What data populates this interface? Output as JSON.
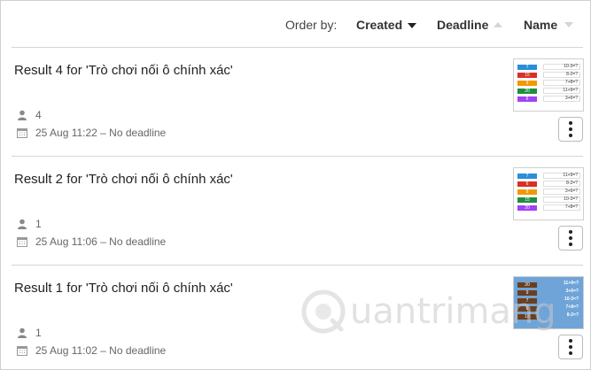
{
  "order_bar": {
    "label": "Order by:",
    "sorts": [
      {
        "label": "Created",
        "state": "active-desc"
      },
      {
        "label": "Deadline",
        "state": "inactive-asc"
      },
      {
        "label": "Name",
        "state": "inactive-desc"
      }
    ]
  },
  "results": [
    {
      "title": "Result 4 for 'Trò chơi nối ô chính xác'",
      "count": "4",
      "date": "25 Aug 11:22 – No deadline",
      "thumb": {
        "tiles": [
          {
            "text": "7",
            "color": "#2a8fd9"
          },
          {
            "text": "15",
            "color": "#d93025"
          },
          {
            "text": "9",
            "color": "#f29900"
          },
          {
            "text": "20",
            "color": "#1e8e3e"
          },
          {
            "text": "6",
            "color": "#a142f4"
          }
        ],
        "equations": [
          "10-3=?",
          "8-2=?",
          "7+8=?",
          "11+9=?",
          "3+6=?"
        ]
      }
    },
    {
      "title": "Result 2 for 'Trò chơi nối ô chính xác'",
      "count": "1",
      "date": "25 Aug 11:06 – No deadline",
      "thumb": {
        "tiles": [
          {
            "text": "7",
            "color": "#2a8fd9"
          },
          {
            "text": "6",
            "color": "#d93025"
          },
          {
            "text": "9",
            "color": "#f29900"
          },
          {
            "text": "15",
            "color": "#1e8e3e"
          },
          {
            "text": "20",
            "color": "#a142f4"
          }
        ],
        "equations": [
          "11+9=?",
          "8-2=?",
          "3+6=?",
          "10-3=?",
          "7+8=?"
        ]
      }
    },
    {
      "title": "Result 1 for 'Trò chơi nối ô chính xác'",
      "count": "1",
      "date": "25 Aug 11:02 – No deadline",
      "thumb": {
        "bg": "#6fa4d8",
        "tiles": [
          {
            "text": "20",
            "color": "#6b3f1f"
          },
          {
            "text": "9",
            "color": "#6b3f1f"
          },
          {
            "text": "7",
            "color": "#6b3f1f"
          },
          {
            "text": "6",
            "color": "#6b3f1f"
          },
          {
            "text": "15",
            "color": "#6b3f1f"
          }
        ],
        "equations": [
          "11+9=?",
          "3+6=?",
          "10-3=?",
          "7+8=?",
          "8-2=?"
        ]
      }
    }
  ],
  "watermark": {
    "text": "uantrimang"
  }
}
